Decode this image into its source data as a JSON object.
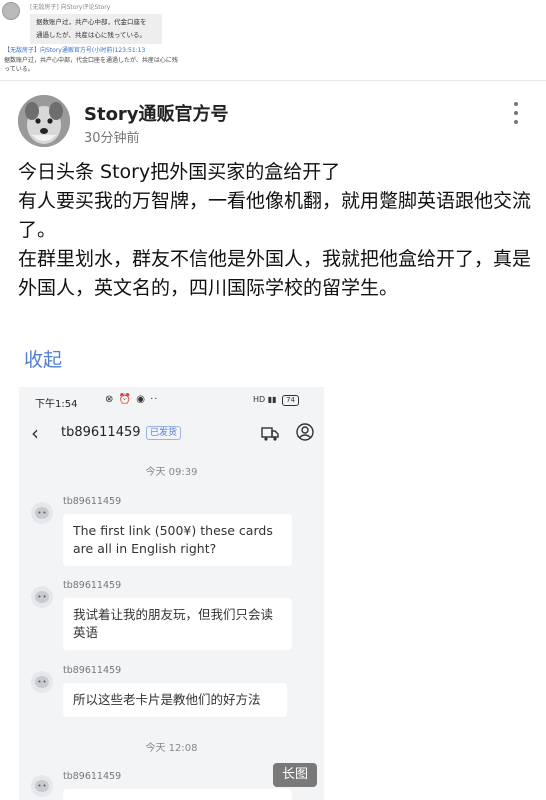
{
  "quoted": {
    "line1": "[无敌房子] 向Story评论Story",
    "box_line1": "据数账户过，共产心中部，代金口座を",
    "box_line2": "通過したが、共産は心に残っている。",
    "line3": "【无敌房子】向Story通贩官方号(小时前)123:51:13",
    "line4": "据数账户过，共产心中部，代金口座を通過したが、共産は心に残",
    "line5": "っている。"
  },
  "post": {
    "author": "Story通贩官方号",
    "time": "30分钟前",
    "paragraphs": [
      "今日头条 Story把外国买家的盒给开了",
      "有人要买我的万智牌，一看他像机翻，就用蹩脚英语跟他交流了。",
      "在群里划水，群友不信他是外国人，我就把他盒给开了，真是外国人，英文名的，四川国际学校的留学生。"
    ],
    "collapse_label": "收起"
  },
  "screenshot": {
    "status_time": "下午1:54",
    "status_icons": "⊗ ⏰ ◉ ··",
    "status_right": "HD ▮▮",
    "battery": "74",
    "chat_user": "tb89611459",
    "badge": "已发货",
    "timestamp1": "今天 09:39",
    "timestamp2": "今天 12:08",
    "messages": [
      {
        "sender": "tb89611459",
        "text": "The first link (500¥) these cards are all in English right?"
      },
      {
        "sender": "tb89611459",
        "text": "我试着让我的朋友玩，但我们只会读英语"
      },
      {
        "sender": "tb89611459",
        "text": "所以这些老卡片是教他们的好方法"
      },
      {
        "sender": "tb89611459",
        "text": ""
      }
    ],
    "long_image_label": "长图"
  },
  "colors": {
    "link": "#4f7ed0",
    "badge": "#5b7bd6",
    "chat_bg": "#f3f4f6"
  }
}
